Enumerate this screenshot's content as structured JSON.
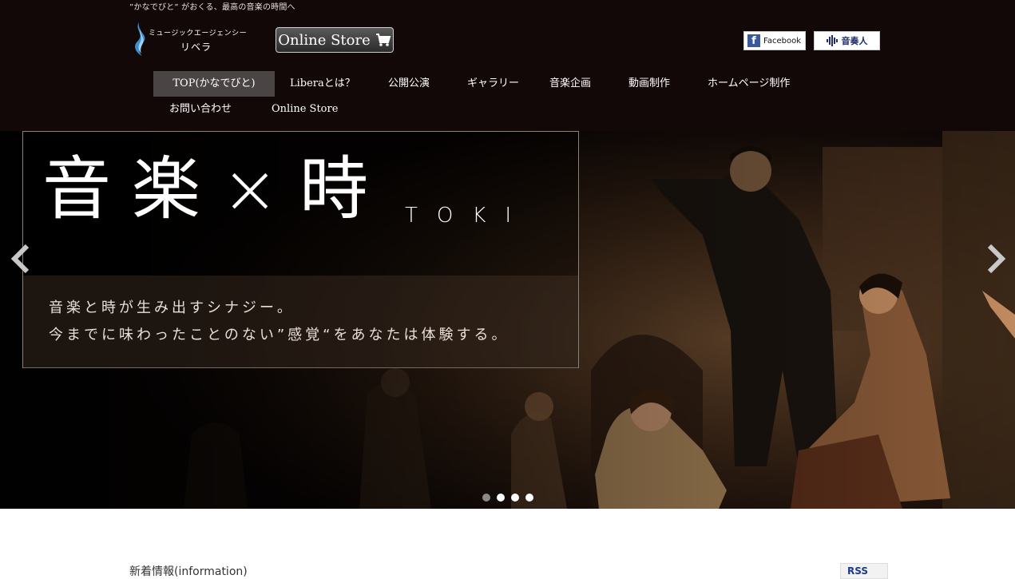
{
  "header": {
    "tagline": "”かなでびと” がおくる、最高の音楽の時間へ",
    "logo_sub": "ミュージックエージェンシー",
    "logo_name": "リベラ",
    "store_button": "Online Store",
    "facebook_label": "Facebook",
    "sousou_label": "音奏人"
  },
  "nav": {
    "items": [
      {
        "label": "TOP(かなでびと)",
        "active": true
      },
      {
        "label": "Liberaとは？"
      },
      {
        "label": "公開公演"
      },
      {
        "label": "ギャラリー"
      },
      {
        "label": "音楽企画"
      },
      {
        "label": "動画制作"
      },
      {
        "label": "ホームページ制作"
      },
      {
        "label": "お問い合わせ"
      },
      {
        "label": "Online Store"
      }
    ]
  },
  "hero": {
    "title": "音楽×時",
    "title_sub": "TOKI",
    "line1": "音楽と時が生み出すシナジー。",
    "line2": "今までに味わったことのない”感覚“をあなたは体験する。",
    "slide_count": 4,
    "active_slide": 1
  },
  "news": {
    "title": "新着情報(information)",
    "rss": "RSS"
  },
  "colors": {
    "header_bg": "#120808",
    "nav_active_bg": "#4a4444",
    "facebook_blue": "#3b5998"
  }
}
